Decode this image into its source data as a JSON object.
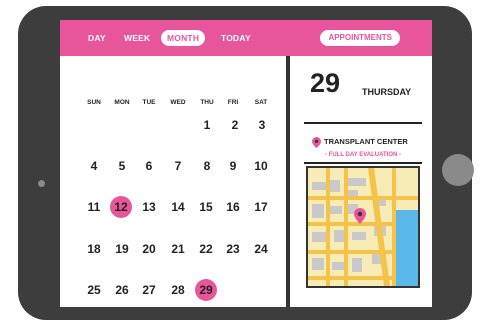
{
  "header": {
    "tabs": [
      {
        "label": "DAY"
      },
      {
        "label": "WEEK"
      },
      {
        "label": "MONTH"
      },
      {
        "label": "TODAY"
      }
    ],
    "appointments_label": "APPOINTMENTS"
  },
  "calendar": {
    "weekdays": [
      "SUN",
      "MON",
      "TUE",
      "WED",
      "THU",
      "FRI",
      "SAT"
    ],
    "days": [
      "1",
      "2",
      "3",
      "4",
      "5",
      "6",
      "7",
      "8",
      "9",
      "10",
      "11",
      "12",
      "13",
      "14",
      "15",
      "16",
      "17",
      "18",
      "19",
      "20",
      "21",
      "22",
      "23",
      "24",
      "25",
      "26",
      "27",
      "28",
      "29"
    ]
  },
  "agenda": {
    "date": "29",
    "weekday": "THURSDAY",
    "event_title": "TRANSPLANT CENTER",
    "event_subtitle": "- FULL DAY EVALUATION -"
  },
  "colors": {
    "accent": "#e9559a",
    "bezel": "#3d3d3d",
    "water": "#5bb8ea",
    "map_land": "#f7ecb5",
    "map_road": "#f5c24a"
  }
}
